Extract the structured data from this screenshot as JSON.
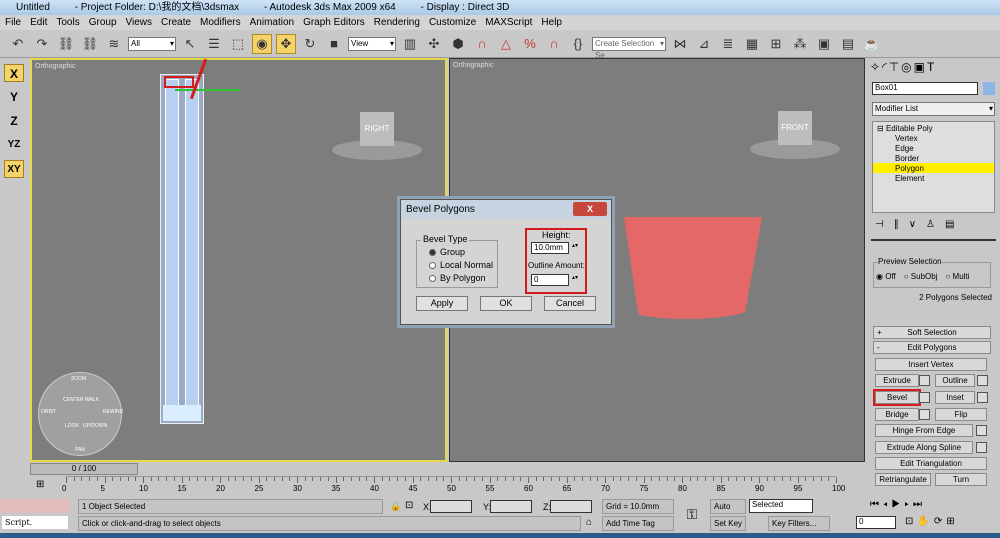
{
  "title": {
    "parts": [
      "Untitled",
      "- Project Folder: D:\\我的文档\\3dsmax",
      "- Autodesk 3ds Max  2009 x64",
      "- Display : Direct 3D"
    ]
  },
  "menu": [
    "File",
    "Edit",
    "Tools",
    "Group",
    "Views",
    "Create",
    "Modifiers",
    "Animation",
    "Graph Editors",
    "Rendering",
    "Customize",
    "MAXScript",
    "Help"
  ],
  "toolbar": {
    "selection_filter": "All",
    "ref_coord": "View",
    "named_selection_placeholder": "Create Selection Se"
  },
  "axis_constraints": [
    "X",
    "Y",
    "Z",
    "YZ",
    "XY"
  ],
  "viewports": {
    "left": {
      "label": "Orthographic",
      "cube": "RIGHT"
    },
    "right": {
      "label": "Orthographic",
      "cube": "FRONT"
    }
  },
  "steering_wheel": [
    "ZOOM",
    "ORBIT",
    "CENTER",
    "WALK",
    "REWIND",
    "LOOK",
    "UP/DOWN",
    "PAN"
  ],
  "dialog": {
    "title": "Bevel Polygons",
    "close": "X",
    "group_label": "Bevel Type",
    "options": [
      "Group",
      "Local Normal",
      "By Polygon"
    ],
    "selected_option": "Group",
    "height_label": "Height:",
    "height_value": "10.0mm",
    "outline_label": "Outline Amount:",
    "outline_value": "0",
    "apply": "Apply",
    "ok": "OK",
    "cancel": "Cancel"
  },
  "panel": {
    "object_name": "Box01",
    "object_color": "#8fb4e6",
    "modifier_list": "Modifier List",
    "stack": [
      "Editable Poly",
      "Vertex",
      "Edge",
      "Border",
      "Polygon",
      "Element"
    ],
    "stack_selected": "Polygon",
    "preview_label": "Preview Selection",
    "preview_options": [
      "Off",
      "SubObj",
      "Multi"
    ],
    "preview_selected": "Off",
    "selection_status": "2 Polygons Selected",
    "soft_selection": "Soft Selection",
    "soft_sign": "+",
    "edit_polygons": "Edit Polygons",
    "edit_sign": "-",
    "insert_vertex": "Insert Vertex",
    "extrude": "Extrude",
    "outline": "Outline",
    "bevel": "Bevel",
    "inset": "Inset",
    "bridge": "Bridge",
    "flip": "Flip",
    "hinge": "Hinge From Edge",
    "extrude_spline": "Extrude Along Spline",
    "edit_triangulation": "Edit Triangulation",
    "retriangulate": "Retriangulate",
    "turn": "Turn"
  },
  "timeline": {
    "frame": "0 / 100",
    "ticks": [
      "0",
      "5",
      "10",
      "15",
      "20",
      "25",
      "30",
      "35",
      "40",
      "45",
      "50",
      "55",
      "60",
      "65",
      "70",
      "75",
      "80",
      "85",
      "90",
      "95",
      "100"
    ]
  },
  "status": {
    "selected": "1 Object Selected",
    "prompt": "Click or click-and-drag to select objects",
    "x_label": "X:",
    "y_label": "Y:",
    "z_label": "Z:",
    "grid": "Grid = 10.0mm",
    "add_time_tag": "Add Time Tag",
    "auto_key": "Auto Key",
    "set_key": "Set Key",
    "key_mode": "Selected",
    "key_filters": "Key Filters...",
    "frame_field": "0",
    "script": "Script."
  },
  "highlight_color": "#d41c1c",
  "selection_color": "#ffee00"
}
